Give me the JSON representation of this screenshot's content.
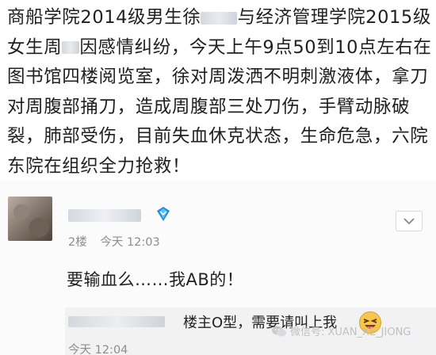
{
  "post": {
    "segments": [
      "商船学院2014级男生徐",
      "与经济管理学院2015级女生周",
      "因感情纠纷，今天上午9点50到10点左右在图书馆四楼阅览室，徐对周泼洒不明刺激液体，拿刀对周腹部捅刀，造成周腹部三处刀伤，手臂动脉破裂，肺部受伤，目前失血休克状态，生命危急，六院东院在组织全力抢救！"
    ]
  },
  "comment": {
    "floor": "2楼",
    "time": "今天 12:03",
    "body": "要输血么……我AB的！",
    "icons": {
      "vip": "vip-badge-icon",
      "more": "chevron-down-icon"
    }
  },
  "reply": {
    "text": "楼主O型，需要请叫上我",
    "time": "今天 12:04",
    "emoji": "laughing-emoji-icon"
  },
  "watermark": {
    "text": "微信号: XUAN_XE_JIONG",
    "icon": "wechat-icon"
  },
  "colors": {
    "text": "#1f1f1f",
    "meta": "#8e8e8e",
    "vip_accent": "#1e8fd6"
  }
}
